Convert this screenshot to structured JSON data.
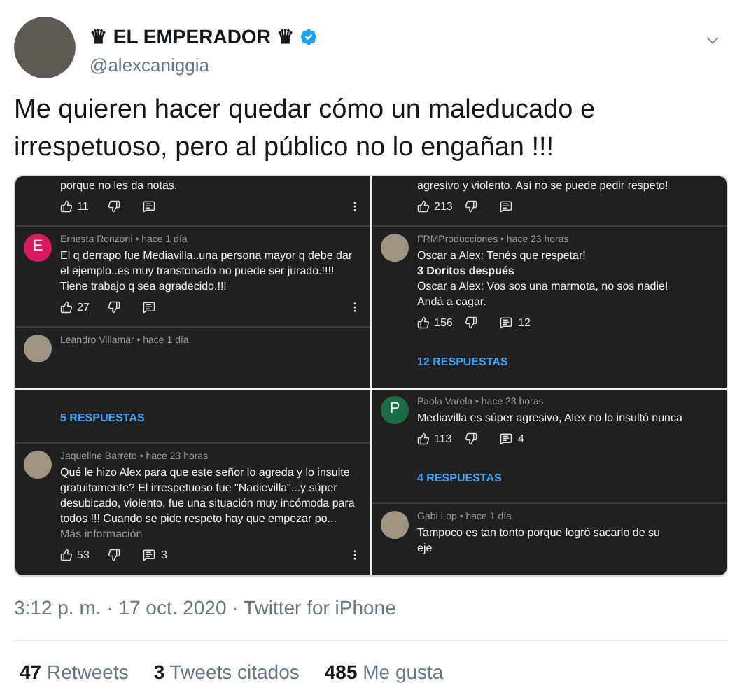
{
  "tweet": {
    "author": {
      "name": "♛ EL EMPERADOR ♛",
      "handle": "@alexcaniggia",
      "verified": true
    },
    "text": "Me quieren hacer quedar cómo un maleducado e irrespetuoso, pero al público no lo engañan !!!",
    "screenshots": [
      {
        "items": [
          {
            "kind": "snippet",
            "text": "porque no les da notas."
          },
          {
            "kind": "actions",
            "likes": "11",
            "menu": true
          },
          {
            "kind": "divider"
          },
          {
            "kind": "comment",
            "avatar": {
              "kind": "letter",
              "letter": "E",
              "color": "#d81b60"
            },
            "meta": "Ernesta Ronzoni • hace 1 día",
            "body": "El q derrapo fue Mediavilla..una persona mayor q debe dar el ejemplo..es muy transtonado no puede ser jurado.!!!! Tiene trabajo q sea agradecido.!!!"
          },
          {
            "kind": "actions",
            "likes": "27",
            "menu": true
          },
          {
            "kind": "divider"
          },
          {
            "kind": "comment",
            "avatar": {
              "kind": "photo"
            },
            "meta": "Leandro Villamar • hace 1 día"
          }
        ]
      },
      {
        "items": [
          {
            "kind": "snippet",
            "text": "agresivo y violento. Así no se puede pedir respeto!"
          },
          {
            "kind": "actions",
            "likes": "213",
            "menu": false
          },
          {
            "kind": "divider"
          },
          {
            "kind": "comment",
            "avatar": {
              "kind": "photo"
            },
            "meta": "FRMProducciones • hace 23 horas",
            "body": "Oscar a Alex: Tenés que respetar!\n**3 Doritos después**\nOscar a Alex: Vos sos una marmota, no sos nadie!\nAndá a cagar."
          },
          {
            "kind": "actions",
            "likes": "156",
            "replies": "12",
            "menu": false
          },
          {
            "kind": "replies",
            "text": "12 RESPUESTAS"
          }
        ]
      },
      {
        "items": [
          {
            "kind": "replies",
            "text": "5 RESPUESTAS"
          },
          {
            "kind": "divider"
          },
          {
            "kind": "comment",
            "avatar": {
              "kind": "photo"
            },
            "meta": "Jaqueline Barreto • hace 23 horas",
            "body": "Qué le hizo Alex para que este señor lo agreda y lo insulte gratuitamente? El irrespetuoso fue \"Nadievilla\"...y súper desubicado, violento, fue una situación muy incómoda para todos !!! Cuando se pide respeto hay que empezar po...",
            "more": "Más información"
          },
          {
            "kind": "actions",
            "likes": "53",
            "replies": "3",
            "menu": true
          }
        ]
      },
      {
        "items": [
          {
            "kind": "comment",
            "avatar": {
              "kind": "letter",
              "letter": "P",
              "color": "#1b6b45"
            },
            "meta": "Paola Varela • hace 23 horas",
            "body": "Mediavilla es súper agresivo, Alex no lo insultó nunca"
          },
          {
            "kind": "actions",
            "likes": "113",
            "replies": "4",
            "menu": false
          },
          {
            "kind": "replies",
            "text": "4 RESPUESTAS"
          },
          {
            "kind": "divider"
          },
          {
            "kind": "comment",
            "avatar": {
              "kind": "photo"
            },
            "meta": "Gabi Lop • hace 1 día",
            "body": "Tampoco es tan tonto porque logró sacarlo de su\neje"
          }
        ]
      }
    ],
    "timestamp": "3:12 p. m. · 17 oct. 2020 · Twitter for iPhone",
    "stats": [
      {
        "count": "47",
        "label": "Retweets"
      },
      {
        "count": "3",
        "label": "Tweets citados"
      },
      {
        "count": "485",
        "label": "Me gusta"
      }
    ]
  }
}
